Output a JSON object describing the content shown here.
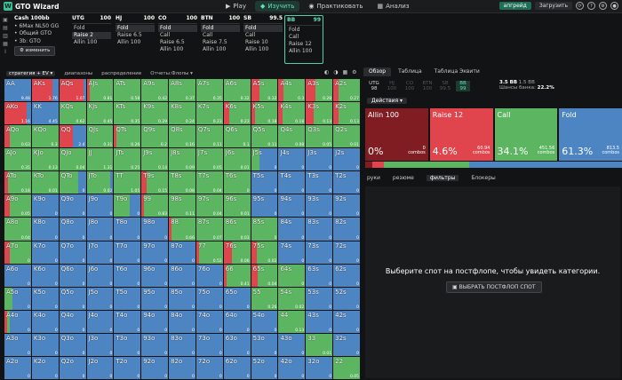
{
  "app": {
    "title": "GTO Wizard",
    "logo_letter": "W"
  },
  "nav": [
    {
      "label": "Play",
      "icon": "play-icon",
      "glyph": "▶",
      "active": false
    },
    {
      "label": "Изучить",
      "icon": "book-icon",
      "glyph": "◆",
      "active": true
    },
    {
      "label": "Практиковать",
      "icon": "gamepad-icon",
      "glyph": "◉",
      "active": false
    },
    {
      "label": "Анализ",
      "icon": "chart-icon",
      "glyph": "▦",
      "active": false
    }
  ],
  "topright": {
    "upgrade": "апгрейд",
    "download": "Загрузить"
  },
  "spot": {
    "title": "Cash 100bb",
    "format": "6Max NLS0 GG",
    "gto": "Общий GTO",
    "bet": "3b: GTO",
    "change": "изменить"
  },
  "positions": [
    {
      "name": "UTG",
      "stack": "100",
      "actions": [
        "Fold",
        "Raise 2",
        "Allin 100"
      ],
      "sel": 1,
      "current": false
    },
    {
      "name": "HJ",
      "stack": "100",
      "actions": [
        "Fold",
        "Raise 6.5",
        "Allin 100"
      ],
      "sel": 0,
      "current": false
    },
    {
      "name": "CO",
      "stack": "100",
      "actions": [
        "Fold",
        "Call",
        "Raise 6.5",
        "Allin 100"
      ],
      "sel": 0,
      "current": false
    },
    {
      "name": "BTN",
      "stack": "100",
      "actions": [
        "Fold",
        "Call",
        "Raise 7.5",
        "Allin 100"
      ],
      "sel": 0,
      "current": false
    },
    {
      "name": "SB",
      "stack": "99.5",
      "actions": [
        "Fold",
        "Call",
        "Raise 10",
        "Allin 100"
      ],
      "sel": 0,
      "current": false
    },
    {
      "name": "BB",
      "stack": "99",
      "actions": [
        "Fold",
        "Call",
        "Raise 12",
        "Allin 100"
      ],
      "sel": -1,
      "current": true
    }
  ],
  "gridbar": {
    "strategy": "стратегия + EV",
    "ranges": "диапазоны",
    "distribution": "распределение",
    "reports": "Отчеты:Флопы"
  },
  "colors": {
    "allin": "#7f1d22",
    "raise": "#e0444c",
    "call": "#5cb560",
    "fold": "#4d85c3"
  },
  "grid": [
    [
      [
        "AA",
        0,
        0,
        0,
        1,
        "9.48"
      ],
      [
        "AKs",
        0,
        0.76,
        0,
        0.24,
        "1.76"
      ],
      [
        "AQs",
        0,
        0.9,
        0,
        0.1,
        "1.07"
      ],
      [
        "AJs",
        0,
        0.1,
        0.9,
        0,
        "0.81"
      ],
      [
        "ATs",
        0,
        0,
        1,
        0,
        "0.58"
      ],
      [
        "A9s",
        0,
        0,
        1,
        0,
        "0.42"
      ],
      [
        "A8s",
        0,
        0,
        1,
        0,
        "0.37"
      ],
      [
        "A7s",
        0,
        0,
        1,
        0,
        "0.35"
      ],
      [
        "A6s",
        0,
        0,
        1,
        0,
        "0.32"
      ],
      [
        "A5s",
        0,
        0.3,
        0.7,
        0,
        "0.32"
      ],
      [
        "A4s",
        0,
        0.2,
        0.8,
        0,
        "0.3"
      ],
      [
        "A3s",
        0,
        0.35,
        0.65,
        0,
        "0.28"
      ],
      [
        "A2s",
        0,
        0.2,
        0.8,
        0,
        "0.27"
      ]
    ],
    [
      [
        "AKo",
        0,
        0.85,
        0,
        0.15,
        "1.16"
      ],
      [
        "KK",
        0,
        0,
        0,
        1,
        "4.45"
      ],
      [
        "KQs",
        0,
        0,
        1,
        0,
        "0.62"
      ],
      [
        "KJs",
        0,
        0,
        1,
        0,
        "0.45"
      ],
      [
        "KTs",
        0,
        0,
        1,
        0,
        "0.35"
      ],
      [
        "K9s",
        0,
        0,
        1,
        0,
        "0.29"
      ],
      [
        "K8s",
        0,
        0,
        1,
        0,
        "0.24"
      ],
      [
        "K7s",
        0,
        0,
        1,
        0,
        "0.23"
      ],
      [
        "K6s",
        0,
        0.2,
        0.8,
        0,
        "0.23"
      ],
      [
        "K5s",
        0,
        0.15,
        0.85,
        0,
        "0.18"
      ],
      [
        "K4s",
        0,
        0.15,
        0.85,
        0,
        "0.18"
      ],
      [
        "K3s",
        0,
        0.3,
        0.7,
        0,
        "0.13"
      ],
      [
        "K2s",
        0,
        0.2,
        0.8,
        0,
        "0.13"
      ]
    ],
    [
      [
        "AQo",
        0,
        0.2,
        0.8,
        0,
        "0.63"
      ],
      [
        "KQo",
        0,
        0,
        1,
        0,
        "0.3"
      ],
      [
        "QQ",
        0,
        0.5,
        0,
        0.5,
        "2.4"
      ],
      [
        "QJs",
        0,
        0,
        1,
        0,
        "0.31"
      ],
      [
        "QTs",
        0,
        0.1,
        0.9,
        0,
        "0.26"
      ],
      [
        "Q9s",
        0,
        0,
        1,
        0,
        "0.2"
      ],
      [
        "Q8s",
        0,
        0,
        1,
        0,
        "0.16"
      ],
      [
        "Q7s",
        0,
        0,
        1,
        0,
        "0.11"
      ],
      [
        "Q6s",
        0,
        0,
        1,
        0,
        "0.1"
      ],
      [
        "Q5s",
        0,
        0,
        1,
        0,
        "0.11"
      ],
      [
        "Q4s",
        0,
        0,
        1,
        0,
        "0.08"
      ],
      [
        "Q3s",
        0,
        0,
        1,
        0,
        "0.05"
      ],
      [
        "Q2s",
        0,
        0,
        1,
        0,
        "0.01"
      ]
    ],
    [
      [
        "AJo",
        0,
        0,
        1,
        0,
        "0.35"
      ],
      [
        "KJo",
        0,
        0,
        1,
        0,
        "0.13"
      ],
      [
        "QJo",
        0,
        0,
        1,
        0,
        "0.04"
      ],
      [
        "JJ",
        0,
        0,
        1,
        0,
        "1.31"
      ],
      [
        "JTs",
        0,
        0,
        1,
        0,
        "0.25"
      ],
      [
        "J9s",
        0,
        0,
        1,
        0,
        "0.14"
      ],
      [
        "J8s",
        0,
        0,
        1,
        0,
        "0.09"
      ],
      [
        "J7s",
        0,
        0,
        1,
        0,
        "0.05"
      ],
      [
        "J6s",
        0,
        0,
        1,
        0,
        "0.01"
      ],
      [
        "J5s",
        0,
        0,
        0.3,
        0.7,
        "0"
      ],
      [
        "J4s",
        0,
        0,
        0,
        1,
        "0"
      ],
      [
        "J3s",
        0,
        0,
        0,
        1,
        "0"
      ],
      [
        "J2s",
        0,
        0,
        0,
        1,
        "0"
      ]
    ],
    [
      [
        "ATo",
        0,
        0.15,
        0.85,
        0,
        "0.18"
      ],
      [
        "KTo",
        0,
        0,
        1,
        0,
        "0.01"
      ],
      [
        "QTo",
        0,
        0,
        0.7,
        0.3,
        "0"
      ],
      [
        "JTo",
        0,
        0,
        0.9,
        0.1,
        "0.02"
      ],
      [
        "TT",
        0,
        0,
        1,
        0,
        "1.05"
      ],
      [
        "T9s",
        0,
        0.2,
        0.8,
        0,
        "0.15"
      ],
      [
        "T8s",
        0,
        0,
        1,
        0,
        "0.08"
      ],
      [
        "T7s",
        0,
        0,
        1,
        0,
        "0.04"
      ],
      [
        "T6s",
        0,
        0,
        1,
        0,
        "0"
      ],
      [
        "T5s",
        0,
        0,
        0,
        1,
        "0"
      ],
      [
        "T4s",
        0,
        0,
        0,
        1,
        "0"
      ],
      [
        "T3s",
        0,
        0,
        0,
        1,
        "0"
      ],
      [
        "T2s",
        0,
        0,
        0,
        1,
        "0"
      ]
    ],
    [
      [
        "A9o",
        0,
        0.2,
        0.8,
        0,
        "0.05"
      ],
      [
        "K9o",
        0,
        0,
        0,
        1,
        "0"
      ],
      [
        "Q9o",
        0,
        0,
        0,
        1,
        "0"
      ],
      [
        "J9o",
        0,
        0,
        0,
        1,
        "0"
      ],
      [
        "T9o",
        0,
        0,
        0.6,
        0.4,
        "0"
      ],
      [
        "99",
        0,
        0.1,
        0.9,
        0,
        "0.83"
      ],
      [
        "98s",
        0,
        0,
        1,
        0,
        "0.11"
      ],
      [
        "97s",
        0,
        0,
        1,
        0,
        "0.04"
      ],
      [
        "96s",
        0,
        0,
        1,
        0,
        "0.01"
      ],
      [
        "95s",
        0,
        0,
        0,
        1,
        "0"
      ],
      [
        "94s",
        0,
        0,
        0,
        1,
        "0"
      ],
      [
        "93s",
        0,
        0,
        0,
        1,
        "0"
      ],
      [
        "92s",
        0,
        0,
        0,
        1,
        "0"
      ]
    ],
    [
      [
        "A8o",
        0,
        0,
        1,
        0,
        "0.04"
      ],
      [
        "K8o",
        0,
        0,
        0,
        1,
        "0"
      ],
      [
        "Q8o",
        0,
        0,
        0,
        1,
        "0"
      ],
      [
        "J8o",
        0,
        0,
        0,
        1,
        "0"
      ],
      [
        "T8o",
        0,
        0,
        0,
        1,
        "0"
      ],
      [
        "98o",
        0,
        0,
        0,
        1,
        "0"
      ],
      [
        "88",
        0,
        0.1,
        0.9,
        0,
        "0.66"
      ],
      [
        "87s",
        0,
        0,
        1,
        0,
        "0.07"
      ],
      [
        "86s",
        0,
        0,
        1,
        0,
        "0.03"
      ],
      [
        "85s",
        0,
        0,
        1,
        0,
        "0"
      ],
      [
        "84s",
        0,
        0,
        0,
        1,
        "0"
      ],
      [
        "83s",
        0,
        0,
        0,
        1,
        "0"
      ],
      [
        "82s",
        0,
        0,
        0,
        1,
        "0"
      ]
    ],
    [
      [
        "A7o",
        0,
        0.2,
        0.8,
        0,
        "0"
      ],
      [
        "K7o",
        0,
        0,
        0,
        1,
        "0"
      ],
      [
        "Q7o",
        0,
        0,
        0,
        1,
        "0"
      ],
      [
        "J7o",
        0,
        0,
        0,
        1,
        "0"
      ],
      [
        "T7o",
        0,
        0,
        0,
        1,
        "0"
      ],
      [
        "97o",
        0,
        0,
        0,
        1,
        "0"
      ],
      [
        "87o",
        0,
        0,
        0,
        1,
        "0"
      ],
      [
        "77",
        0,
        0.1,
        0.9,
        0,
        "0.52"
      ],
      [
        "76s",
        0,
        0.3,
        0.7,
        0,
        "0.06"
      ],
      [
        "75s",
        0,
        0.2,
        0.8,
        0,
        "0.02"
      ],
      [
        "74s",
        0,
        0,
        0,
        1,
        "0"
      ],
      [
        "73s",
        0,
        0,
        0,
        1,
        "0"
      ],
      [
        "72s",
        0,
        0,
        0,
        1,
        "0"
      ]
    ],
    [
      [
        "A6o",
        0,
        0,
        0,
        1,
        "0"
      ],
      [
        "K6o",
        0,
        0,
        0,
        1,
        "0"
      ],
      [
        "Q6o",
        0,
        0,
        0,
        1,
        "0"
      ],
      [
        "J6o",
        0,
        0,
        0,
        1,
        "0"
      ],
      [
        "T6o",
        0,
        0,
        0,
        1,
        "0"
      ],
      [
        "96o",
        0,
        0,
        0,
        1,
        "0"
      ],
      [
        "86o",
        0,
        0,
        0,
        1,
        "0"
      ],
      [
        "76o",
        0,
        0,
        0,
        1,
        "0"
      ],
      [
        "66",
        0,
        0.1,
        0.9,
        0,
        "0.41"
      ],
      [
        "65s",
        0,
        0.25,
        0.75,
        0,
        "0.04"
      ],
      [
        "64s",
        0,
        0,
        1,
        0,
        "0"
      ],
      [
        "63s",
        0,
        0,
        0,
        1,
        "0"
      ],
      [
        "62s",
        0,
        0,
        0,
        1,
        "0"
      ]
    ],
    [
      [
        "A5o",
        0,
        0,
        0.3,
        0.7,
        "0"
      ],
      [
        "K5o",
        0,
        0,
        0,
        1,
        "0"
      ],
      [
        "Q5o",
        0,
        0,
        0,
        1,
        "0"
      ],
      [
        "J5o",
        0,
        0,
        0,
        1,
        "0"
      ],
      [
        "T5o",
        0,
        0,
        0,
        1,
        "0"
      ],
      [
        "95o",
        0,
        0,
        0,
        1,
        "0"
      ],
      [
        "85o",
        0,
        0,
        0,
        1,
        "0"
      ],
      [
        "75o",
        0,
        0,
        0,
        1,
        "0"
      ],
      [
        "65o",
        0,
        0,
        0,
        1,
        "0"
      ],
      [
        "55",
        0,
        0,
        1,
        0,
        "0.26"
      ],
      [
        "54s",
        0,
        0,
        1,
        0,
        "0.02"
      ],
      [
        "53s",
        0,
        0,
        0,
        1,
        "0"
      ],
      [
        "52s",
        0,
        0,
        0,
        1,
        "0"
      ]
    ],
    [
      [
        "A4o",
        0,
        0.1,
        0.1,
        0.8,
        "0"
      ],
      [
        "K4o",
        0,
        0,
        0,
        1,
        "0"
      ],
      [
        "Q4o",
        0,
        0,
        0,
        1,
        "0"
      ],
      [
        "J4o",
        0,
        0,
        0,
        1,
        "0"
      ],
      [
        "T4o",
        0,
        0,
        0,
        1,
        "0"
      ],
      [
        "94o",
        0,
        0,
        0,
        1,
        "0"
      ],
      [
        "84o",
        0,
        0,
        0,
        1,
        "0"
      ],
      [
        "74o",
        0,
        0,
        0,
        1,
        "0"
      ],
      [
        "64o",
        0,
        0,
        0,
        1,
        "0"
      ],
      [
        "54o",
        0,
        0,
        0,
        1,
        "0"
      ],
      [
        "44",
        0,
        0,
        1,
        0,
        "0.13"
      ],
      [
        "43s",
        0,
        0,
        0,
        1,
        "0"
      ],
      [
        "42s",
        0,
        0,
        0,
        1,
        "0"
      ]
    ],
    [
      [
        "A3o",
        0,
        0,
        0,
        1,
        "0"
      ],
      [
        "K3o",
        0,
        0,
        0,
        1,
        "0"
      ],
      [
        "Q3o",
        0,
        0,
        0,
        1,
        "0"
      ],
      [
        "J3o",
        0,
        0,
        0,
        1,
        "0"
      ],
      [
        "T3o",
        0,
        0,
        0,
        1,
        "0"
      ],
      [
        "93o",
        0,
        0,
        0,
        1,
        "0"
      ],
      [
        "83o",
        0,
        0,
        0,
        1,
        "0"
      ],
      [
        "73o",
        0,
        0,
        0,
        1,
        "0"
      ],
      [
        "63o",
        0,
        0,
        0,
        1,
        "0"
      ],
      [
        "53o",
        0,
        0,
        0,
        1,
        "0"
      ],
      [
        "43o",
        0,
        0,
        0,
        1,
        "0"
      ],
      [
        "33",
        0,
        0,
        1,
        0,
        "0.01"
      ],
      [
        "32s",
        0,
        0,
        0,
        1,
        "0"
      ]
    ],
    [
      [
        "A2o",
        0,
        0,
        0,
        1,
        "0"
      ],
      [
        "K2o",
        0,
        0,
        0,
        1,
        "0"
      ],
      [
        "Q2o",
        0,
        0,
        0,
        1,
        "0"
      ],
      [
        "J2o",
        0,
        0,
        0,
        1,
        "0"
      ],
      [
        "T2o",
        0,
        0,
        0,
        1,
        "0"
      ],
      [
        "92o",
        0,
        0,
        0,
        1,
        "0"
      ],
      [
        "82o",
        0,
        0,
        0,
        1,
        "0"
      ],
      [
        "72o",
        0,
        0,
        0,
        1,
        "0"
      ],
      [
        "62o",
        0,
        0,
        0,
        1,
        "0"
      ],
      [
        "52o",
        0,
        0,
        0,
        1,
        "0"
      ],
      [
        "42o",
        0,
        0,
        0,
        1,
        "0"
      ],
      [
        "32o",
        0,
        0,
        0,
        1,
        "0"
      ],
      [
        "22",
        0,
        0,
        1,
        0,
        "0.05"
      ]
    ]
  ],
  "rtabs": [
    "Обзор",
    "Таблица",
    "Таблица Эквити"
  ],
  "rpos": [
    {
      "n": "UTG",
      "s": "98",
      "st": "on"
    },
    {
      "n": "HJ",
      "s": "100",
      "st": "off"
    },
    {
      "n": "CO",
      "s": "100",
      "st": "off"
    },
    {
      "n": "BTN",
      "s": "100",
      "st": "off"
    },
    {
      "n": "SB",
      "s": "99.5",
      "st": "off"
    },
    {
      "n": "BB",
      "s": "99",
      "st": "cur"
    }
  ],
  "rinfo": {
    "pot": "3.5 BB",
    "bb": "1.5 BB",
    "odds_label": "Шансы банка:",
    "odds": "22.2%"
  },
  "actions_label": "Действия",
  "cards": [
    {
      "name": "Allin 100",
      "pct": "0%",
      "combos": "0",
      "combo_label": "combos",
      "color": "#7f1d22",
      "frac": 0.0
    },
    {
      "name": "Raise 12",
      "pct": "4.6%",
      "combos": "60.94",
      "combo_label": "combos",
      "color": "#e0444c",
      "frac": 0.046
    },
    {
      "name": "Call",
      "pct": "34.1%",
      "combos": "451.56",
      "combo_label": "combos",
      "color": "#5cb560",
      "frac": 0.341
    },
    {
      "name": "Fold",
      "pct": "61.3%",
      "combos": "813.5",
      "combo_label": "combos",
      "color": "#4d85c3",
      "frac": 0.613
    }
  ],
  "btabs": [
    "руки",
    "резюме",
    "фильтры",
    "Блокеры"
  ],
  "empty": {
    "msg": "Выберите спот на постфлопе, чтобы увидеть категории.",
    "btn": "ВЫБРАТЬ ПОСТФЛОП СПОТ"
  }
}
